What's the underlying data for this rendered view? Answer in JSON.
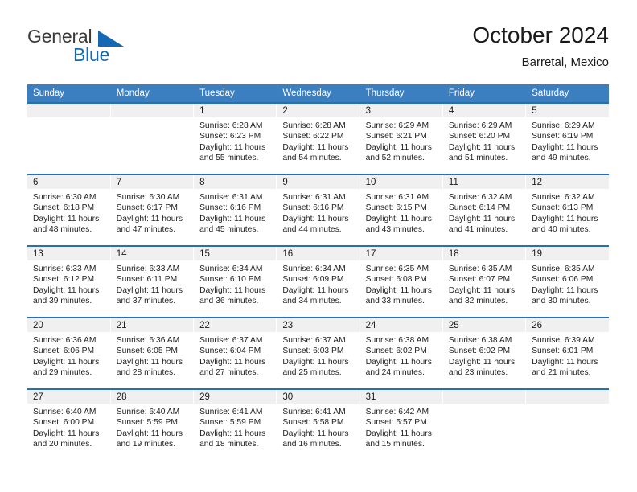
{
  "brand": {
    "name_top": "General",
    "name_bottom": "Blue",
    "triangle_color": "#1569b4",
    "text_color": "#3a3a3a"
  },
  "header": {
    "title": "October 2024",
    "subtitle": "Barretal, Mexico"
  },
  "colors": {
    "header_blue": "#3c7fc1",
    "row_rule_blue": "#2470b4",
    "daynum_bg": "#f0f0f0"
  },
  "weekdays": [
    "Sunday",
    "Monday",
    "Tuesday",
    "Wednesday",
    "Thursday",
    "Friday",
    "Saturday"
  ],
  "weeks": [
    [
      {
        "day": "",
        "empty": true
      },
      {
        "day": "",
        "empty": true
      },
      {
        "day": "1",
        "sunrise": "Sunrise: 6:28 AM",
        "sunset": "Sunset: 6:23 PM",
        "daylight1": "Daylight: 11 hours",
        "daylight2": "and 55 minutes."
      },
      {
        "day": "2",
        "sunrise": "Sunrise: 6:28 AM",
        "sunset": "Sunset: 6:22 PM",
        "daylight1": "Daylight: 11 hours",
        "daylight2": "and 54 minutes."
      },
      {
        "day": "3",
        "sunrise": "Sunrise: 6:29 AM",
        "sunset": "Sunset: 6:21 PM",
        "daylight1": "Daylight: 11 hours",
        "daylight2": "and 52 minutes."
      },
      {
        "day": "4",
        "sunrise": "Sunrise: 6:29 AM",
        "sunset": "Sunset: 6:20 PM",
        "daylight1": "Daylight: 11 hours",
        "daylight2": "and 51 minutes."
      },
      {
        "day": "5",
        "sunrise": "Sunrise: 6:29 AM",
        "sunset": "Sunset: 6:19 PM",
        "daylight1": "Daylight: 11 hours",
        "daylight2": "and 49 minutes."
      }
    ],
    [
      {
        "day": "6",
        "sunrise": "Sunrise: 6:30 AM",
        "sunset": "Sunset: 6:18 PM",
        "daylight1": "Daylight: 11 hours",
        "daylight2": "and 48 minutes."
      },
      {
        "day": "7",
        "sunrise": "Sunrise: 6:30 AM",
        "sunset": "Sunset: 6:17 PM",
        "daylight1": "Daylight: 11 hours",
        "daylight2": "and 47 minutes."
      },
      {
        "day": "8",
        "sunrise": "Sunrise: 6:31 AM",
        "sunset": "Sunset: 6:16 PM",
        "daylight1": "Daylight: 11 hours",
        "daylight2": "and 45 minutes."
      },
      {
        "day": "9",
        "sunrise": "Sunrise: 6:31 AM",
        "sunset": "Sunset: 6:16 PM",
        "daylight1": "Daylight: 11 hours",
        "daylight2": "and 44 minutes."
      },
      {
        "day": "10",
        "sunrise": "Sunrise: 6:31 AM",
        "sunset": "Sunset: 6:15 PM",
        "daylight1": "Daylight: 11 hours",
        "daylight2": "and 43 minutes."
      },
      {
        "day": "11",
        "sunrise": "Sunrise: 6:32 AM",
        "sunset": "Sunset: 6:14 PM",
        "daylight1": "Daylight: 11 hours",
        "daylight2": "and 41 minutes."
      },
      {
        "day": "12",
        "sunrise": "Sunrise: 6:32 AM",
        "sunset": "Sunset: 6:13 PM",
        "daylight1": "Daylight: 11 hours",
        "daylight2": "and 40 minutes."
      }
    ],
    [
      {
        "day": "13",
        "sunrise": "Sunrise: 6:33 AM",
        "sunset": "Sunset: 6:12 PM",
        "daylight1": "Daylight: 11 hours",
        "daylight2": "and 39 minutes."
      },
      {
        "day": "14",
        "sunrise": "Sunrise: 6:33 AM",
        "sunset": "Sunset: 6:11 PM",
        "daylight1": "Daylight: 11 hours",
        "daylight2": "and 37 minutes."
      },
      {
        "day": "15",
        "sunrise": "Sunrise: 6:34 AM",
        "sunset": "Sunset: 6:10 PM",
        "daylight1": "Daylight: 11 hours",
        "daylight2": "and 36 minutes."
      },
      {
        "day": "16",
        "sunrise": "Sunrise: 6:34 AM",
        "sunset": "Sunset: 6:09 PM",
        "daylight1": "Daylight: 11 hours",
        "daylight2": "and 34 minutes."
      },
      {
        "day": "17",
        "sunrise": "Sunrise: 6:35 AM",
        "sunset": "Sunset: 6:08 PM",
        "daylight1": "Daylight: 11 hours",
        "daylight2": "and 33 minutes."
      },
      {
        "day": "18",
        "sunrise": "Sunrise: 6:35 AM",
        "sunset": "Sunset: 6:07 PM",
        "daylight1": "Daylight: 11 hours",
        "daylight2": "and 32 minutes."
      },
      {
        "day": "19",
        "sunrise": "Sunrise: 6:35 AM",
        "sunset": "Sunset: 6:06 PM",
        "daylight1": "Daylight: 11 hours",
        "daylight2": "and 30 minutes."
      }
    ],
    [
      {
        "day": "20",
        "sunrise": "Sunrise: 6:36 AM",
        "sunset": "Sunset: 6:06 PM",
        "daylight1": "Daylight: 11 hours",
        "daylight2": "and 29 minutes."
      },
      {
        "day": "21",
        "sunrise": "Sunrise: 6:36 AM",
        "sunset": "Sunset: 6:05 PM",
        "daylight1": "Daylight: 11 hours",
        "daylight2": "and 28 minutes."
      },
      {
        "day": "22",
        "sunrise": "Sunrise: 6:37 AM",
        "sunset": "Sunset: 6:04 PM",
        "daylight1": "Daylight: 11 hours",
        "daylight2": "and 27 minutes."
      },
      {
        "day": "23",
        "sunrise": "Sunrise: 6:37 AM",
        "sunset": "Sunset: 6:03 PM",
        "daylight1": "Daylight: 11 hours",
        "daylight2": "and 25 minutes."
      },
      {
        "day": "24",
        "sunrise": "Sunrise: 6:38 AM",
        "sunset": "Sunset: 6:02 PM",
        "daylight1": "Daylight: 11 hours",
        "daylight2": "and 24 minutes."
      },
      {
        "day": "25",
        "sunrise": "Sunrise: 6:38 AM",
        "sunset": "Sunset: 6:02 PM",
        "daylight1": "Daylight: 11 hours",
        "daylight2": "and 23 minutes."
      },
      {
        "day": "26",
        "sunrise": "Sunrise: 6:39 AM",
        "sunset": "Sunset: 6:01 PM",
        "daylight1": "Daylight: 11 hours",
        "daylight2": "and 21 minutes."
      }
    ],
    [
      {
        "day": "27",
        "sunrise": "Sunrise: 6:40 AM",
        "sunset": "Sunset: 6:00 PM",
        "daylight1": "Daylight: 11 hours",
        "daylight2": "and 20 minutes."
      },
      {
        "day": "28",
        "sunrise": "Sunrise: 6:40 AM",
        "sunset": "Sunset: 5:59 PM",
        "daylight1": "Daylight: 11 hours",
        "daylight2": "and 19 minutes."
      },
      {
        "day": "29",
        "sunrise": "Sunrise: 6:41 AM",
        "sunset": "Sunset: 5:59 PM",
        "daylight1": "Daylight: 11 hours",
        "daylight2": "and 18 minutes."
      },
      {
        "day": "30",
        "sunrise": "Sunrise: 6:41 AM",
        "sunset": "Sunset: 5:58 PM",
        "daylight1": "Daylight: 11 hours",
        "daylight2": "and 16 minutes."
      },
      {
        "day": "31",
        "sunrise": "Sunrise: 6:42 AM",
        "sunset": "Sunset: 5:57 PM",
        "daylight1": "Daylight: 11 hours",
        "daylight2": "and 15 minutes."
      },
      {
        "day": "",
        "empty": true
      },
      {
        "day": "",
        "empty": true
      }
    ]
  ]
}
